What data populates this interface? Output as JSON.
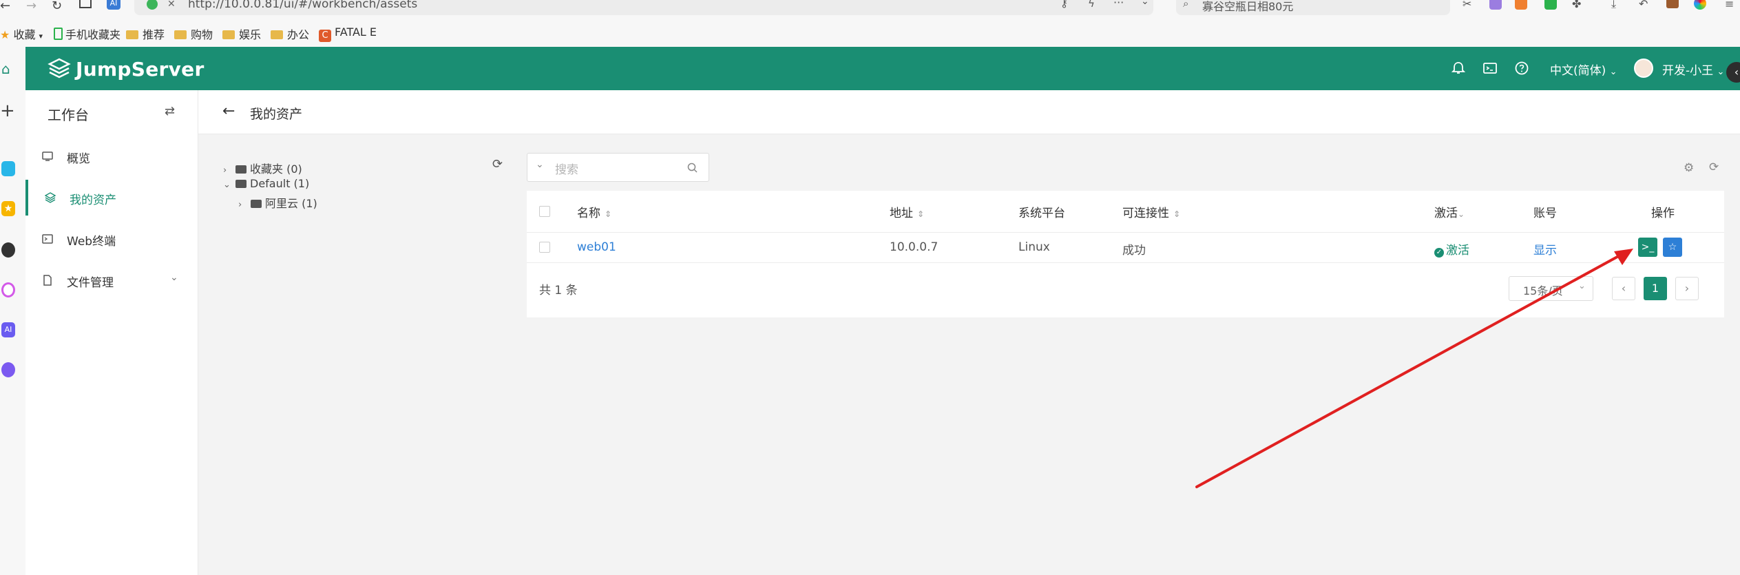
{
  "browser": {
    "url": "http://10.0.0.81/ui/#/workbench/assets",
    "search_text": "寡谷空瓶日相80元",
    "bookmarks": [
      "收藏",
      "手机收藏夹",
      "推荐",
      "购物",
      "娱乐",
      "办公",
      "FATAL E"
    ]
  },
  "header": {
    "brand": "JumpServer",
    "language": "中文(简体)",
    "user": "开发-小王"
  },
  "sidebar": {
    "title": "工作台",
    "items": [
      {
        "label": "概览",
        "icon": "monitor-icon"
      },
      {
        "label": "我的资产",
        "icon": "layers-icon"
      },
      {
        "label": "Web终端",
        "icon": "terminal-icon"
      },
      {
        "label": "文件管理",
        "icon": "file-icon"
      }
    ]
  },
  "page": {
    "title": "我的资产"
  },
  "tree": {
    "nodes": [
      {
        "label": "收藏夹 (0)"
      },
      {
        "label": "Default (1)"
      },
      {
        "label": "阿里云 (1)"
      }
    ]
  },
  "search": {
    "placeholder": "搜索"
  },
  "table": {
    "columns": [
      "名称",
      "地址",
      "系统平台",
      "可连接性",
      "激活",
      "账号",
      "操作"
    ],
    "rows": [
      {
        "name": "web01",
        "address": "10.0.0.7",
        "platform": "Linux",
        "connectivity": "成功",
        "active": "激活",
        "account": "显示"
      }
    ],
    "total": "共 1 条",
    "page_size": "15条/页",
    "current_page": "1"
  },
  "colors": {
    "brand": "#1a8e73",
    "link": "#2d7fd6",
    "annotation_arrow": "#e02020"
  }
}
